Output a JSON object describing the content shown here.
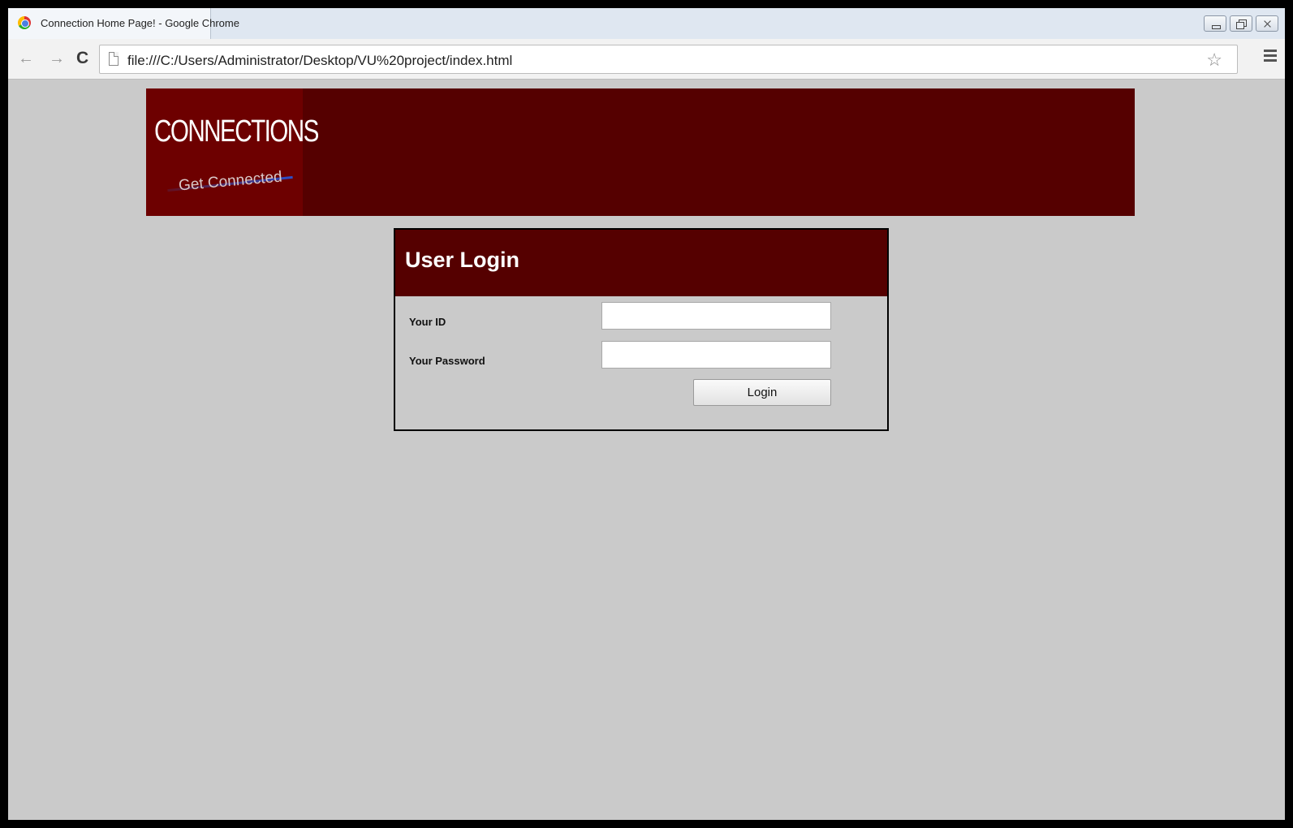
{
  "browser": {
    "tab_title": "Connection Home Page! - Google Chrome",
    "url": "file:///C:/Users/Administrator/Desktop/VU%20project/index.html"
  },
  "banner": {
    "logo_title": "CONNECTIONS",
    "logo_tagline": "Get Connected"
  },
  "login": {
    "heading": "User Login",
    "id_label": "Your ID",
    "password_label": "Your Password",
    "id_value": "",
    "password_value": "",
    "button_label": "Login"
  },
  "colors": {
    "banner_bg": "#550000",
    "logo_bg": "#6d0000",
    "page_bg": "#cacaca"
  }
}
